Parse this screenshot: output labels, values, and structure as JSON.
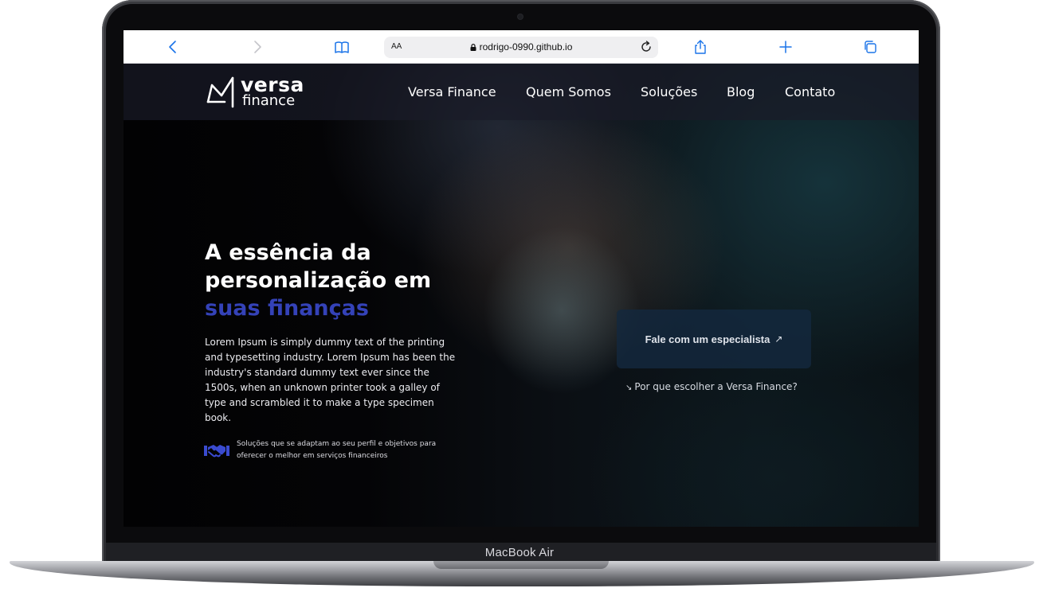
{
  "device": {
    "label": "MacBook Air"
  },
  "browser": {
    "url": "rodrigo-0990.github.io",
    "text_size_label": "AA",
    "buttons": [
      "back-button",
      "forward-button",
      "bookmarks-button",
      "reload-button",
      "share-button",
      "new-tab-button",
      "tabs-button"
    ]
  },
  "site": {
    "logo": {
      "line1": "versa",
      "line2": "finance"
    },
    "nav": [
      "Versa Finance",
      "Quem Somos",
      "Soluções",
      "Blog",
      "Contato"
    ],
    "hero": {
      "title_line1": "A essência da",
      "title_line2": "personalização em",
      "title_accent": "suas finanças",
      "body": "Lorem Ipsum is simply dummy text of the printing and typesetting industry. Lorem Ipsum has been the industry's standard dummy text ever since the 1500s, when an unknown printer took a galley of type and scrambled it to make a type specimen book.",
      "feature_text": "Soluções que se adaptam ao seu perfil e objetivos para oferecer o melhor em serviços financeiros",
      "feature_icon": "handshake-icon"
    },
    "cta": {
      "label": "Fale com um especialista",
      "arrow": "↗"
    },
    "secondary_link": {
      "arrow": "↘",
      "label": "Por que escolher a Versa Finance?"
    },
    "colors": {
      "accent": "#3442b8",
      "navbar": "#191b28",
      "cta_bg": "#14283e",
      "link": "#1a73e8"
    }
  }
}
